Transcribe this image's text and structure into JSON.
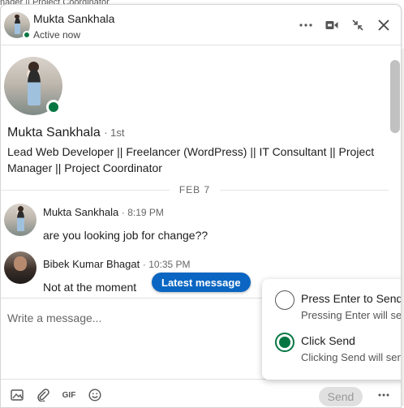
{
  "background": {
    "top_text": "nager || Project Coordinator"
  },
  "header": {
    "name": "Mukta Sankhala",
    "status": "Active now",
    "icons": [
      "more-icon",
      "video-icon",
      "minimize-icon",
      "close-icon"
    ]
  },
  "profile": {
    "name": "Mukta Sankhala",
    "degree": "· 1st",
    "headline": "Lead Web Developer || Freelancer (WordPress) || IT Consultant || Project Manager || Project Coordinator"
  },
  "conversation": {
    "date_label": "FEB 7",
    "messages": [
      {
        "sender": "Mukta Sankhala",
        "time": "· 8:19 PM",
        "text": "are you looking job for change??"
      },
      {
        "sender": "Bibek Kumar Bhagat",
        "time": "· 10:35 PM",
        "text": "Not at the moment"
      }
    ],
    "latest_button": "Latest message"
  },
  "composer": {
    "placeholder": "Write a message...",
    "send_label": "Send"
  },
  "send_options": [
    {
      "title": "Press Enter to Send",
      "desc": "Pressing Enter will send",
      "selected": false
    },
    {
      "title": "Click Send",
      "desc": "Clicking Send will send",
      "selected": true
    }
  ],
  "colors": {
    "accent": "#0a66c2",
    "online": "#057642"
  }
}
